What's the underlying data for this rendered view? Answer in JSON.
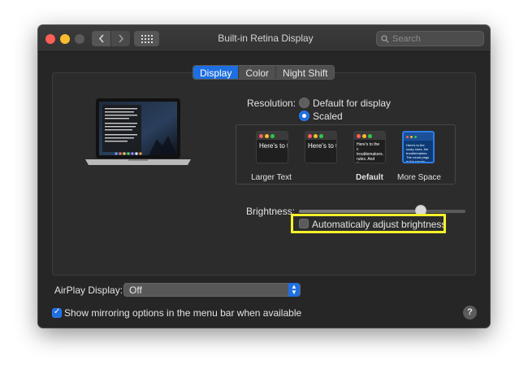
{
  "window": {
    "title": "Built-in Retina Display"
  },
  "search": {
    "placeholder": "Search"
  },
  "tabs": [
    {
      "label": "Display",
      "active": true
    },
    {
      "label": "Color",
      "active": false
    },
    {
      "label": "Night Shift",
      "active": false
    }
  ],
  "resolution": {
    "label": "Resolution:",
    "options": [
      {
        "label": "Default for display",
        "selected": false
      },
      {
        "label": "Scaled",
        "selected": true
      }
    ]
  },
  "scaling": {
    "thumbnails": [
      {
        "label": "Larger Text",
        "text": "Here's to troublem",
        "selected": false,
        "bold": false
      },
      {
        "label": "",
        "text": "Here's to troublema",
        "selected": false,
        "bold": false
      },
      {
        "label": "Default",
        "text": "Here's to the c troublemakers. rules. And they",
        "selected": false,
        "bold": true
      },
      {
        "label": "More Space",
        "text": "Here's to the crazy ones, the troublemakers. The round pegs in the square holes.",
        "selected": true,
        "bold": false
      }
    ]
  },
  "brightness": {
    "label": "Brightness:",
    "level": 0.74,
    "auto_adjust_label": "Automatically adjust brightness",
    "auto_adjust_checked": false
  },
  "airplay": {
    "label": "AirPlay Display:",
    "value": "Off"
  },
  "mirroring": {
    "label": "Show mirroring options in the menu bar when available",
    "checked": true
  },
  "help": {
    "label": "?"
  },
  "colors": {
    "accent": "#1e6fe0",
    "highlight": "#f6f12a"
  }
}
